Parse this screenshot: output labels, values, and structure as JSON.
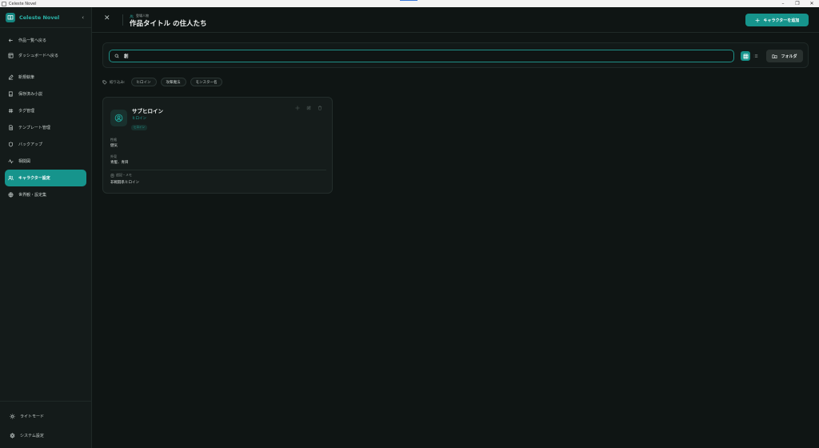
{
  "window": {
    "title": "Celeste Novel",
    "controls": [
      "–",
      "❐",
      "✕"
    ]
  },
  "sidebar": {
    "brand": "Celeste Novel",
    "items": [
      {
        "label": "作品一覧へ戻る",
        "icon": "arrow-left-icon"
      },
      {
        "label": "ダッシュボードへ戻る",
        "icon": "dashboard-icon"
      },
      {
        "label": "新規執筆",
        "icon": "pen-icon"
      },
      {
        "label": "保存済み小説",
        "icon": "book-icon"
      },
      {
        "label": "タグ管理",
        "icon": "hash-icon"
      },
      {
        "label": "テンプレート管理",
        "icon": "file-icon"
      },
      {
        "label": "バックアップ",
        "icon": "shield-icon"
      },
      {
        "label": "相関図",
        "icon": "network-icon"
      },
      {
        "label": "キャラクター設定",
        "icon": "users-icon"
      },
      {
        "label": "世界観・設定集",
        "icon": "globe-icon"
      }
    ],
    "bottom": [
      {
        "label": "ライトモード",
        "icon": "sun-icon"
      },
      {
        "label": "システム設定",
        "icon": "gear-icon"
      }
    ]
  },
  "header": {
    "close": "✕",
    "breadcrumb": "登場人物",
    "title": "作品タイトル の住人たち",
    "add_button": "キャラクターを追加"
  },
  "search": {
    "value": "創",
    "folder_button": "フォルダ"
  },
  "filter": {
    "label": "絞り込み:",
    "chips": [
      "ヒロイン",
      "攻撃魔法",
      "モンスター名"
    ]
  },
  "card": {
    "name": "サブヒロイン",
    "role": "ヒロイン",
    "badge": "ヒロイン",
    "personality_label": "性格",
    "personality": "健気",
    "appearance_label": "外見",
    "appearance": "青髪、青目",
    "memo_label": "追記・メモ",
    "memo": "非戦闘系ヒロイン"
  },
  "colors": {
    "accent": "#16948c",
    "background": "#0f1514",
    "sidebar": "#141b1a"
  }
}
